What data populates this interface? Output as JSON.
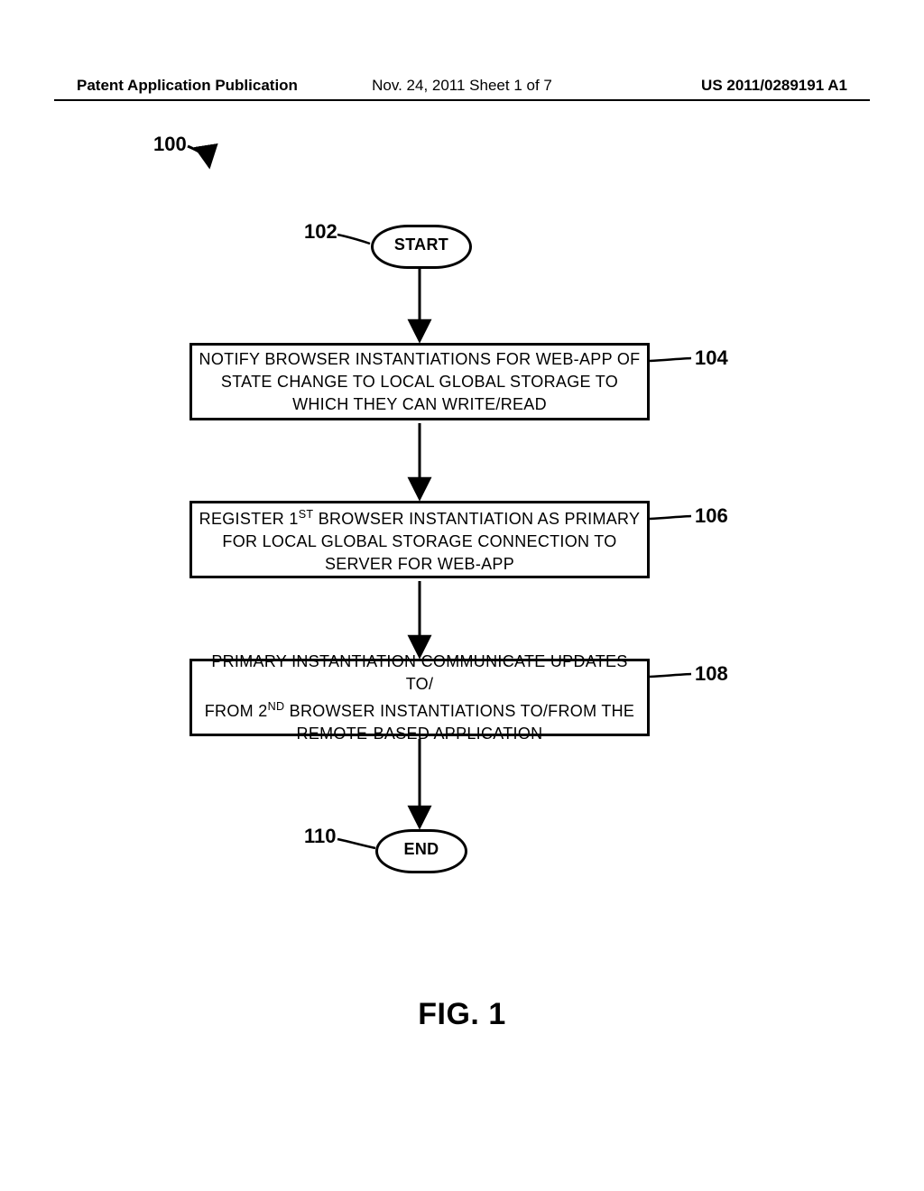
{
  "header": {
    "left": "Patent Application Publication",
    "center": "Nov. 24, 2011   Sheet 1 of 7",
    "right": "US 2011/0289191 A1"
  },
  "labels": {
    "ref_100": "100",
    "ref_102": "102",
    "ref_104": "104",
    "ref_106": "106",
    "ref_108": "108",
    "ref_110": "110"
  },
  "nodes": {
    "start": "START",
    "step_104_line1": "NOTIFY BROWSER INSTANTIATIONS FOR WEB-APP OF",
    "step_104_line2": "STATE CHANGE TO LOCAL GLOBAL STORAGE TO",
    "step_104_line3": "WHICH THEY CAN WRITE/READ",
    "step_106_line1_pre": "REGISTER 1",
    "step_106_line1_sup": "ST",
    "step_106_line1_post": " BROWSER INSTANTIATION AS PRIMARY",
    "step_106_line2": "FOR LOCAL GLOBAL STORAGE CONNECTION TO",
    "step_106_line3": "SERVER FOR WEB-APP",
    "step_108_line1": "PRIMARY INSTANTIATION COMMUNICATE UPDATES TO/",
    "step_108_line2_pre": "FROM 2",
    "step_108_line2_sup": "ND",
    "step_108_line2_post": " BROWSER INSTANTIATIONS TO/FROM THE",
    "step_108_line3": "REMOTE-BASED APPLICATION",
    "end": "END"
  },
  "caption": "FIG. 1",
  "chart_data": {
    "type": "flowchart",
    "title": "FIG. 1",
    "nodes": [
      {
        "id": "100",
        "type": "reference-pointer",
        "label": "100"
      },
      {
        "id": "102",
        "type": "terminator",
        "label": "START"
      },
      {
        "id": "104",
        "type": "process",
        "label": "NOTIFY BROWSER INSTANTIATIONS FOR WEB-APP OF STATE CHANGE TO LOCAL GLOBAL STORAGE TO WHICH THEY CAN WRITE/READ"
      },
      {
        "id": "106",
        "type": "process",
        "label": "REGISTER 1ST BROWSER INSTANTIATION AS PRIMARY FOR LOCAL GLOBAL STORAGE CONNECTION TO SERVER FOR WEB-APP"
      },
      {
        "id": "108",
        "type": "process",
        "label": "PRIMARY INSTANTIATION COMMUNICATE UPDATES TO/FROM 2ND BROWSER INSTANTIATIONS TO/FROM THE REMOTE-BASED APPLICATION"
      },
      {
        "id": "110",
        "type": "terminator",
        "label": "END"
      }
    ],
    "edges": [
      {
        "from": "102",
        "to": "104"
      },
      {
        "from": "104",
        "to": "106"
      },
      {
        "from": "106",
        "to": "108"
      },
      {
        "from": "108",
        "to": "110"
      }
    ]
  }
}
